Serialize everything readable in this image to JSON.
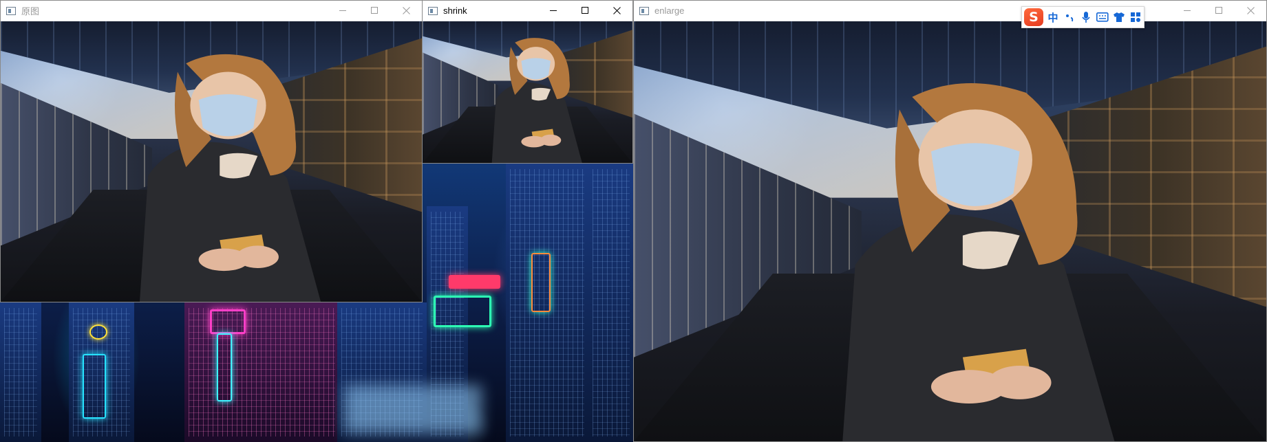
{
  "windows": {
    "original": {
      "title": "原图",
      "active": false
    },
    "shrink": {
      "title": "shrink",
      "active": true
    },
    "enlarge": {
      "title": "enlarge",
      "active": false
    }
  },
  "controls": {
    "minimize_icon": "minimize-icon",
    "maximize_icon": "maximize-icon",
    "close_icon": "close-icon"
  },
  "ime_toolbar": {
    "logo": "S",
    "mode_label": "中",
    "items": [
      "punctuation-icon",
      "microphone-icon",
      "keyboard-icon",
      "skin-icon",
      "toolbox-icon"
    ]
  },
  "colors": {
    "ime_accent": "#1668d6",
    "ime_logo": "#e53b1f",
    "inactive_title": "#999999",
    "active_title": "#000000"
  }
}
